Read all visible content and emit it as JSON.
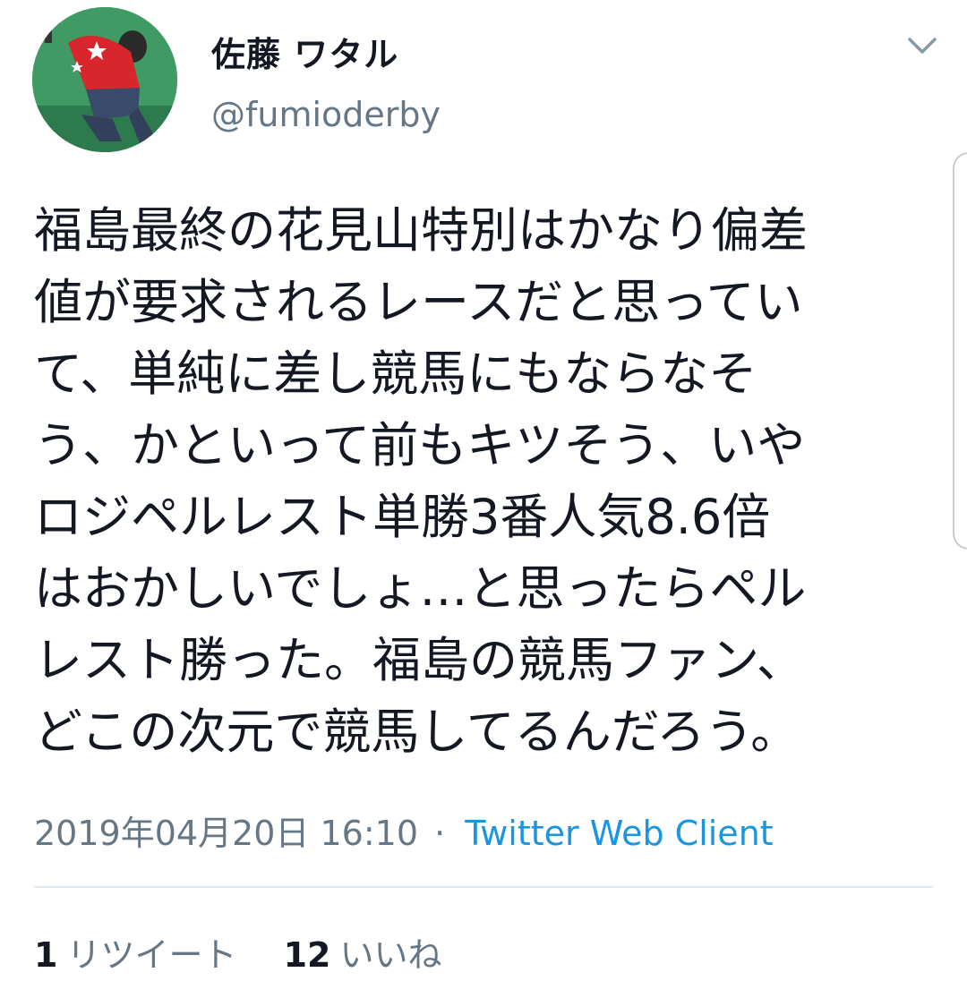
{
  "user": {
    "display_name": "佐藤 ワタル",
    "handle": "@fumioderby",
    "avatar_icon": "user-avatar-photo"
  },
  "menu": {
    "icon": "chevron-down-icon"
  },
  "tweet": {
    "lines": [
      "福島最終の花見山特別はかなり偏差",
      "値が要求されるレースだと思ってい",
      "て、単純に差し競馬にもならなそ",
      "う、かといって前もキツそう、いや",
      "ロジペルレスト単勝3番人気8.6倍",
      "はおかしいでしょ…と思ったらペル",
      "レスト勝った。福島の競馬ファン、",
      "どこの次元で競馬してるんだろう。"
    ]
  },
  "meta": {
    "timestamp": "2019年04月20日 16:10",
    "separator": "·",
    "client": "Twitter Web Client"
  },
  "stats": {
    "retweets_count": "1",
    "retweets_label": "リツイート",
    "likes_count": "12",
    "likes_label": "いいね"
  },
  "colors": {
    "text": "#141823",
    "secondary": "#657786",
    "link": "#1b95e0",
    "divider": "#e1e8ed"
  }
}
